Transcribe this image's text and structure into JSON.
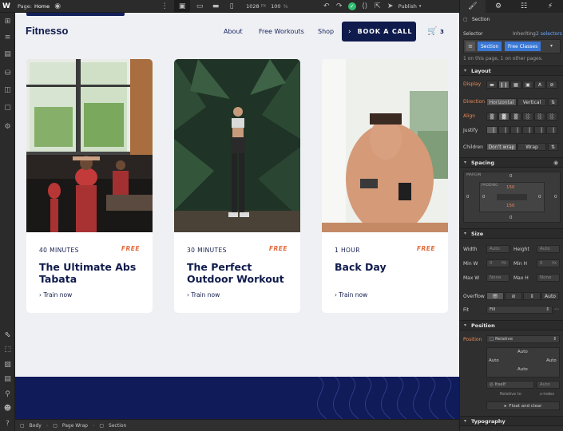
{
  "topbar": {
    "page_label": "Page:",
    "page_name": "Home",
    "width_value": "1028",
    "width_unit": "PX",
    "zoom_value": "100",
    "zoom_unit": "%",
    "publish_label": "Publish"
  },
  "site": {
    "logo": "Fitnesso",
    "nav": [
      "About",
      "Free Workouts",
      "Shop"
    ],
    "cta": "BOOK A CALL",
    "cart_count": "3"
  },
  "cards": [
    {
      "duration": "40 MINUTES",
      "tag": "FREE",
      "title": "The Ultimate Abs Tabata",
      "link": "Train now"
    },
    {
      "duration": "30 MINUTES",
      "tag": "FREE",
      "title": "The Perfect Outdoor Workout",
      "link": "Train now"
    },
    {
      "duration": "1 HOUR",
      "tag": "FREE",
      "title": "Back Day",
      "link": "Train now"
    }
  ],
  "breadcrumb": [
    "Body",
    "Page Wrap",
    "Section"
  ],
  "panel": {
    "element": "Section",
    "selector_label": "Selector",
    "inheriting": "Inheriting",
    "inheriting_count": "2 selectors",
    "class1": "Section",
    "class2": "Free Classes",
    "on_page": "1 on this page, 1 on other pages.",
    "layout": "Layout",
    "display": "Display",
    "direction": "Direction",
    "dir_h": "Horizontal",
    "dir_v": "Vertical",
    "align": "Align",
    "justify": "Justify",
    "children": "Children",
    "nowrap": "Don't wrap",
    "wrap": "Wrap",
    "spacing": "Spacing",
    "margin": "MARGIN",
    "padding": "PADDING",
    "margin_top": "0",
    "margin_bottom": "0",
    "margin_left": "0",
    "margin_right": "0",
    "padding_top": "150",
    "padding_bottom": "150",
    "padding_left": "0",
    "padding_right": "0",
    "size": "Size",
    "width": "Width",
    "height": "Height",
    "minw": "Min W",
    "minh": "Min H",
    "maxw": "Max W",
    "maxh": "Max H",
    "auto": "Auto",
    "zero": "0",
    "px": "PX",
    "none": "None",
    "overflow": "Overflow",
    "overflow_auto": "Auto",
    "fit": "Fit",
    "fit_value": "Fill",
    "position": "Position",
    "position_label": "Position",
    "position_value": "Relative",
    "pos_auto": "Auto",
    "relative_to": "Relative to",
    "itself": "Itself",
    "zindex": "z-index",
    "float": "Float and clear",
    "typography": "Typography"
  },
  "colors": {
    "navy": "#0f1b4c",
    "accent": "#e26a3c",
    "blue": "#4a90d9",
    "canvas": "#eff0f4"
  }
}
